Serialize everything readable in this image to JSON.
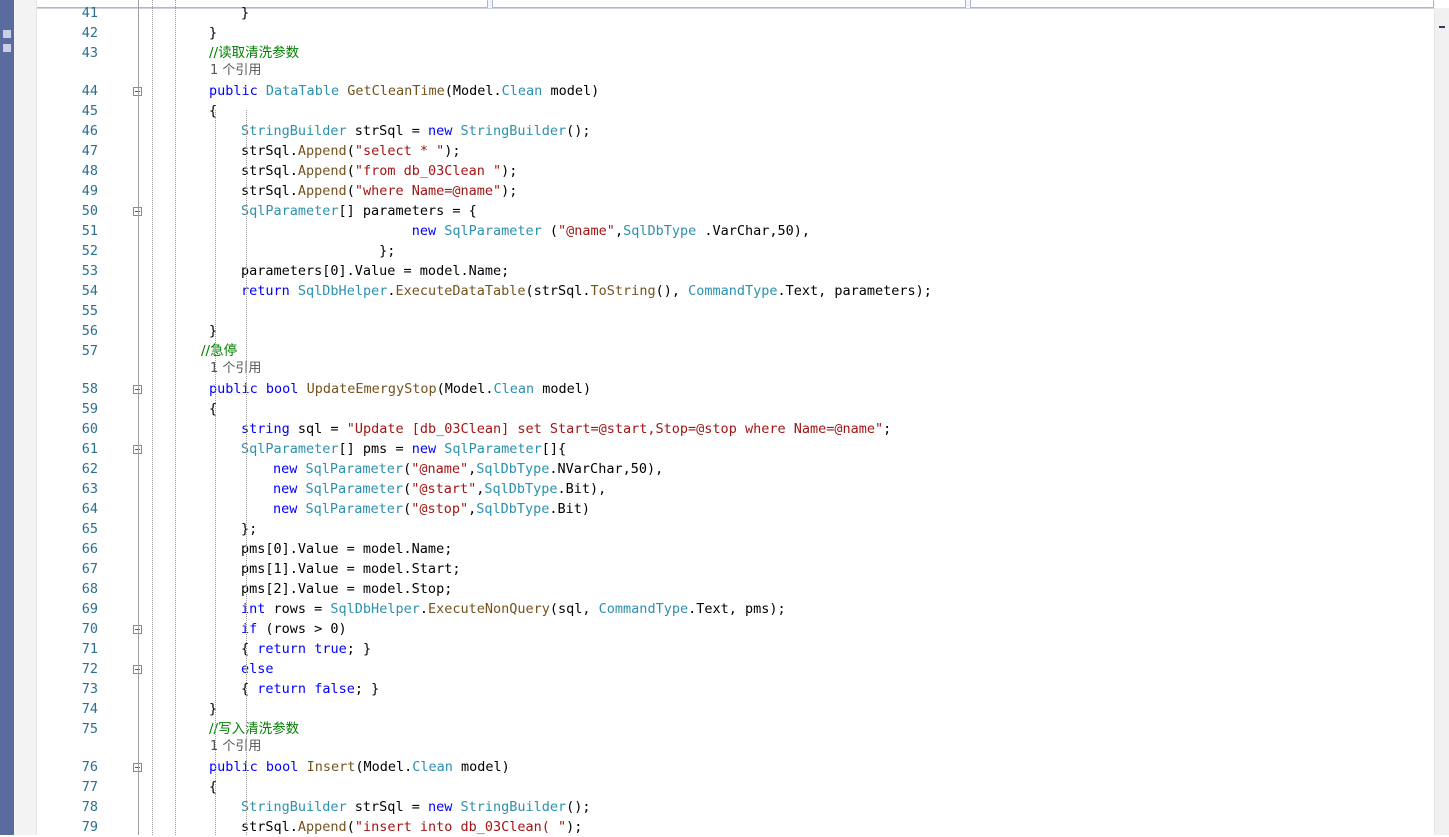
{
  "editor": {
    "reference_label": "1 个引用",
    "lines": [
      {
        "n": "41",
        "indent": 4,
        "html": "}"
      },
      {
        "n": "42",
        "indent": 3,
        "html": "}"
      },
      {
        "n": "43",
        "indent": 3,
        "html": "<span class='c'>//读取清洗参数</span>",
        "ref_after": true
      },
      {
        "n": "44",
        "indent": 3,
        "fold": true,
        "html": "<span class='k'>public</span> <span class='t'>DataTable</span> <span class='m'>GetCleanTime</span>(Model.<span class='t'>Clean</span> model)"
      },
      {
        "n": "45",
        "indent": 3,
        "html": "{"
      },
      {
        "n": "46",
        "indent": 4,
        "html": "<span class='t'>StringBuilder</span> strSql = <span class='k'>new</span> <span class='t'>StringBuilder</span>();"
      },
      {
        "n": "47",
        "indent": 4,
        "html": "strSql.<span class='m'>Append</span>(<span class='s'>\"select * \"</span>);"
      },
      {
        "n": "48",
        "indent": 4,
        "html": "strSql.<span class='m'>Append</span>(<span class='s'>\"from db_03Clean \"</span>);"
      },
      {
        "n": "49",
        "indent": 4,
        "html": "strSql.<span class='m'>Append</span>(<span class='s'>\"where Name=@name\"</span>);"
      },
      {
        "n": "50",
        "indent": 4,
        "fold": true,
        "html": "<span class='t'>SqlParameter</span>[] parameters = {"
      },
      {
        "n": "51",
        "indent": 4,
        "html": "                     <span class='k'>new</span> <span class='t'>SqlParameter</span> (<span class='s'>\"@name\"</span>,<span class='t'>SqlDbType</span> .VarChar,50),"
      },
      {
        "n": "52",
        "indent": 4,
        "html": "                 };"
      },
      {
        "n": "53",
        "indent": 4,
        "html": "parameters[0].Value = model.Name;"
      },
      {
        "n": "54",
        "indent": 4,
        "html": "<span class='k'>return</span> <span class='t'>SqlDbHelper</span>.<span class='m'>ExecuteDataTable</span>(strSql.<span class='m'>ToString</span>(), <span class='t'>CommandType</span>.Text, parameters);"
      },
      {
        "n": "55",
        "indent": 4,
        "html": ""
      },
      {
        "n": "56",
        "indent": 3,
        "html": "}"
      },
      {
        "n": "57",
        "indent": 2,
        "html": "<span class='c'>//急停</span>",
        "ref_after": true
      },
      {
        "n": "58",
        "indent": 3,
        "fold": true,
        "html": "<span class='k'>public</span> <span class='k'>bool</span> <span class='m'>UpdateEmergyStop</span>(Model.<span class='t'>Clean</span> model)"
      },
      {
        "n": "59",
        "indent": 3,
        "html": "{"
      },
      {
        "n": "60",
        "indent": 4,
        "html": "<span class='k'>string</span> sql = <span class='s'>\"Update [db_03Clean] set Start=@start,Stop=@stop where Name=@name\"</span>;"
      },
      {
        "n": "61",
        "indent": 4,
        "fold": true,
        "html": "<span class='t'>SqlParameter</span>[] pms = <span class='k'>new</span> <span class='t'>SqlParameter</span>[]{"
      },
      {
        "n": "62",
        "indent": 5,
        "html": "<span class='k'>new</span> <span class='t'>SqlParameter</span>(<span class='s'>\"@name\"</span>,<span class='t'>SqlDbType</span>.NVarChar,50),"
      },
      {
        "n": "63",
        "indent": 5,
        "html": "<span class='k'>new</span> <span class='t'>SqlParameter</span>(<span class='s'>\"@start\"</span>,<span class='t'>SqlDbType</span>.Bit),"
      },
      {
        "n": "64",
        "indent": 5,
        "html": "<span class='k'>new</span> <span class='t'>SqlParameter</span>(<span class='s'>\"@stop\"</span>,<span class='t'>SqlDbType</span>.Bit)"
      },
      {
        "n": "65",
        "indent": 4,
        "html": "};"
      },
      {
        "n": "66",
        "indent": 4,
        "html": "pms[0].Value = model.Name;"
      },
      {
        "n": "67",
        "indent": 4,
        "html": "pms[1].Value = model.Start;"
      },
      {
        "n": "68",
        "indent": 4,
        "html": "pms[2].Value = model.Stop;"
      },
      {
        "n": "69",
        "indent": 4,
        "html": "<span class='k'>int</span> rows = <span class='t'>SqlDbHelper</span>.<span class='m'>ExecuteNonQuery</span>(sql, <span class='t'>CommandType</span>.Text, pms);"
      },
      {
        "n": "70",
        "indent": 4,
        "fold": true,
        "html": "<span class='k'>if</span> (rows &gt; 0)"
      },
      {
        "n": "71",
        "indent": 4,
        "html": "{ <span class='k'>return</span> <span class='k'>true</span>; }"
      },
      {
        "n": "72",
        "indent": 4,
        "fold": true,
        "html": "<span class='k'>else</span>"
      },
      {
        "n": "73",
        "indent": 4,
        "html": "{ <span class='k'>return</span> <span class='k'>false</span>; }"
      },
      {
        "n": "74",
        "indent": 3,
        "html": "}"
      },
      {
        "n": "75",
        "indent": 3,
        "html": "<span class='c'>//写入清洗参数</span>",
        "ref_after": true
      },
      {
        "n": "76",
        "indent": 3,
        "fold": true,
        "html": "<span class='k'>public</span> <span class='k'>bool</span> <span class='m'>Insert</span>(Model.<span class='t'>Clean</span> model)"
      },
      {
        "n": "77",
        "indent": 3,
        "html": "{"
      },
      {
        "n": "78",
        "indent": 4,
        "html": "<span class='t'>StringBuilder</span> strSql = <span class='k'>new</span> <span class='t'>StringBuilder</span>();"
      },
      {
        "n": "79",
        "indent": 4,
        "html": "strSql.<span class='m'>Append</span>(<span class='s'>\"insert into db_03Clean( \"</span>);"
      }
    ]
  }
}
